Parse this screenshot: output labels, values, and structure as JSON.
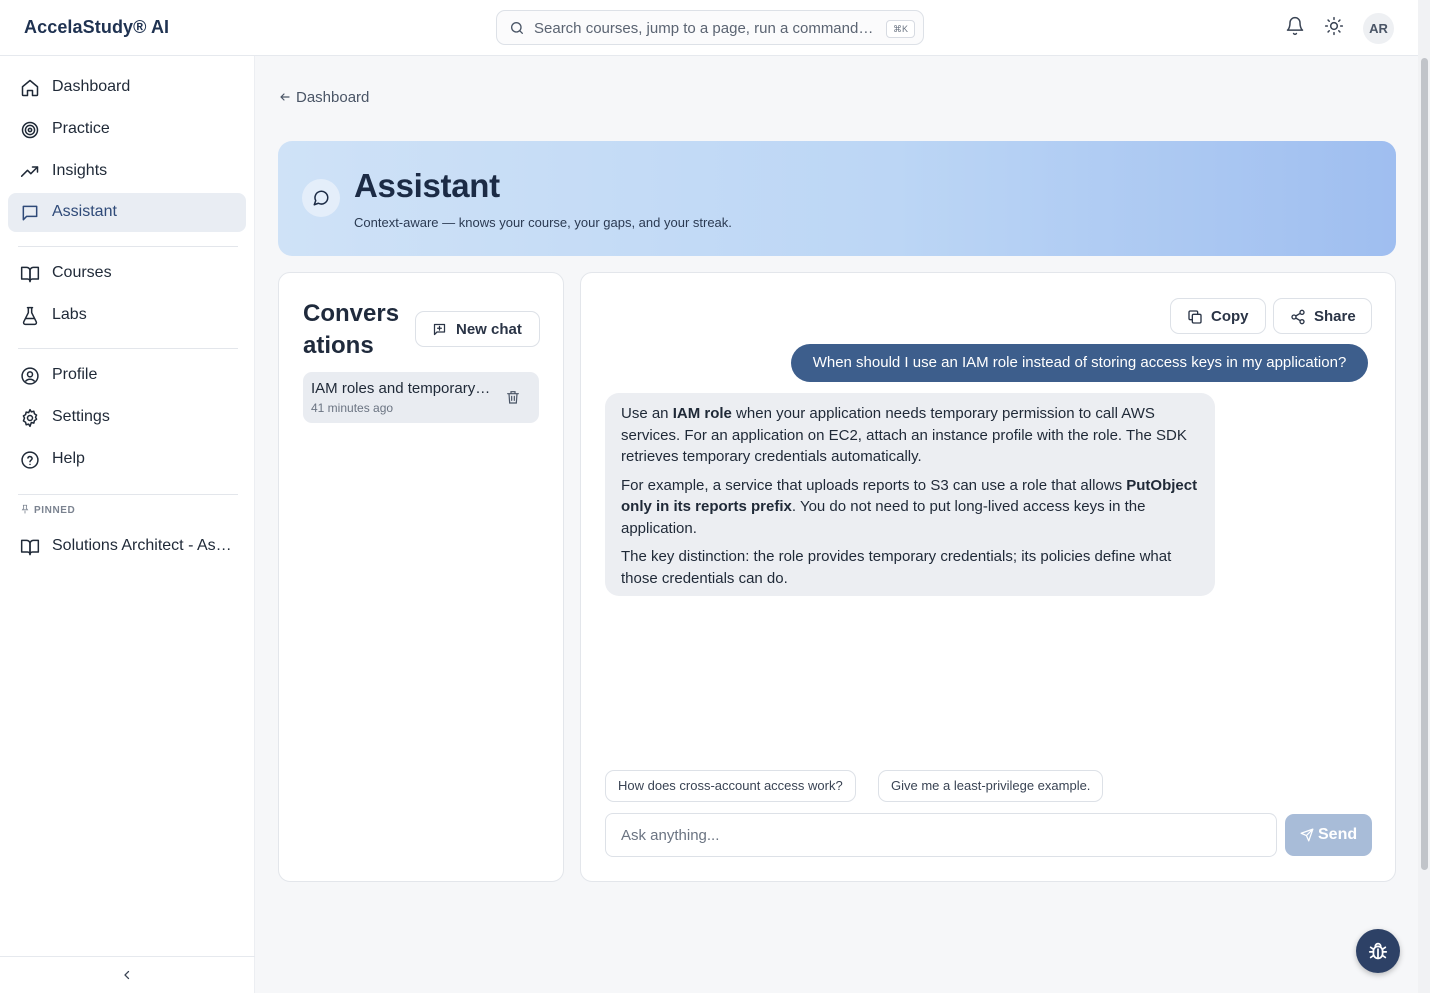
{
  "app": {
    "brand": "AccelaStudy® AI"
  },
  "topbar": {
    "search_placeholder": "Search courses, jump to a page, run a command…",
    "search_shortcut": "⌘K",
    "avatar_initials": "AR"
  },
  "sidebar": {
    "items": [
      {
        "label": "Dashboard",
        "icon": "home-icon",
        "active": false
      },
      {
        "label": "Practice",
        "icon": "target-icon",
        "active": false
      },
      {
        "label": "Insights",
        "icon": "trending-up-icon",
        "active": false
      },
      {
        "label": "Assistant",
        "icon": "message-square-icon",
        "active": true
      },
      {
        "label": "Courses",
        "icon": "book-open-icon",
        "active": false
      },
      {
        "label": "Labs",
        "icon": "flask-icon",
        "active": false
      },
      {
        "label": "Profile",
        "icon": "user-circle-icon",
        "active": false
      },
      {
        "label": "Settings",
        "icon": "gear-icon",
        "active": false
      },
      {
        "label": "Help",
        "icon": "help-circle-icon",
        "active": false
      }
    ],
    "pinned_heading": "PINNED",
    "pinned_items": [
      {
        "label": "Solutions Architect - As…",
        "icon": "book-open-icon"
      }
    ]
  },
  "page": {
    "back_label": "Dashboard",
    "title": "Assistant",
    "subtitle": "Context-aware — knows your course, your gaps, and your streak."
  },
  "conversations": {
    "title": "Conversations",
    "new_chat_label": "New chat",
    "items": [
      {
        "title": "IAM roles and temporary credentials",
        "time": "41 minutes ago"
      }
    ]
  },
  "chat": {
    "copy_label": "Copy",
    "share_label": "Share",
    "user_message": "When should I use an IAM role instead of storing access keys in my application?",
    "assistant_message": {
      "p1_prefix": "Use an ",
      "p1_bold": "IAM role",
      "p1_rest": " when your application needs temporary permission to call AWS services. For an application on EC2, attach an instance profile with the role. The SDK retrieves temporary credentials automatically.",
      "p2_prefix": "For example, a service that uploads reports to S3 can use a role that allows ",
      "p2_bold": "PutObject only in its reports prefix",
      "p2_rest": ". You do not need to put long-lived access keys in the application.",
      "p3": "The key distinction: the role provides temporary credentials; its policies define what those credentials can do."
    },
    "suggestions": [
      "How does cross-account access work?",
      "Give me a least-privilege example."
    ],
    "input_placeholder": "Ask anything...",
    "send_label": "Send"
  },
  "colors": {
    "brand": "#1f3251",
    "user_bubble": "#3d5e8c",
    "send_disabled": "#a8bcd8",
    "active_nav_bg": "#e9edf3"
  }
}
